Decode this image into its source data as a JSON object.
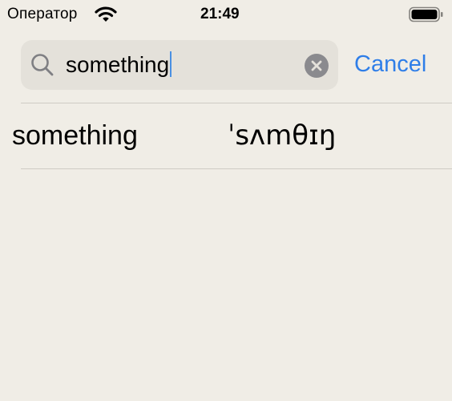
{
  "status_bar": {
    "carrier": "Оператор",
    "time": "21:49",
    "icons": [
      "wifi-icon",
      "battery-icon"
    ]
  },
  "search": {
    "value": "something",
    "icons": [
      "search-icon",
      "clear-icon"
    ],
    "cancel_label": "Cancel"
  },
  "results": [
    {
      "word": "something",
      "transcription": "ˈsʌmθɪŋ"
    }
  ],
  "colors": {
    "background": "#f0ede6",
    "search_field": "#e4e1da",
    "accent": "#2f7ee8",
    "clear_button": "#8a8a8e",
    "separator": "#cfcbc4"
  }
}
